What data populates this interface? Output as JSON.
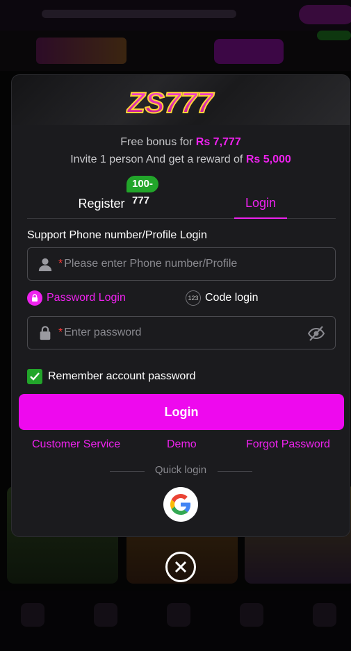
{
  "brand": {
    "logo_text": "ZS777"
  },
  "modal": {
    "bonus_prefix": "Free bonus for",
    "bonus_amount": "Rs 7,777",
    "invite_prefix": "Invite 1 person And get a reward of",
    "invite_amount": "Rs 5,000",
    "tabs": [
      {
        "label": "Register",
        "badge": "100-777",
        "active": false
      },
      {
        "label": "Login",
        "active": true
      }
    ],
    "phone_label": "Support Phone number/Profile Login",
    "phone_required": "*",
    "phone_placeholder": "Please enter Phone number/Profile",
    "login_modes": [
      {
        "label": "Password Login",
        "icon": "lock-icon",
        "active": true
      },
      {
        "label": "Code login",
        "icon": "123-icon",
        "active": false
      }
    ],
    "password_required": "*",
    "password_placeholder": "Enter password",
    "remember_label": "Remember account password",
    "remember_checked": true,
    "login_button": "Login",
    "links": [
      "Customer Service",
      "Demo",
      "Forgot Password"
    ],
    "quick_login_label": "Quick login",
    "quick_login_providers": [
      "google-icon"
    ]
  },
  "colors": {
    "accent": "#ee09ee",
    "badge_green": "#22a52a",
    "modal_bg": "#1b1b1e"
  },
  "close": {
    "icon": "close-icon"
  }
}
